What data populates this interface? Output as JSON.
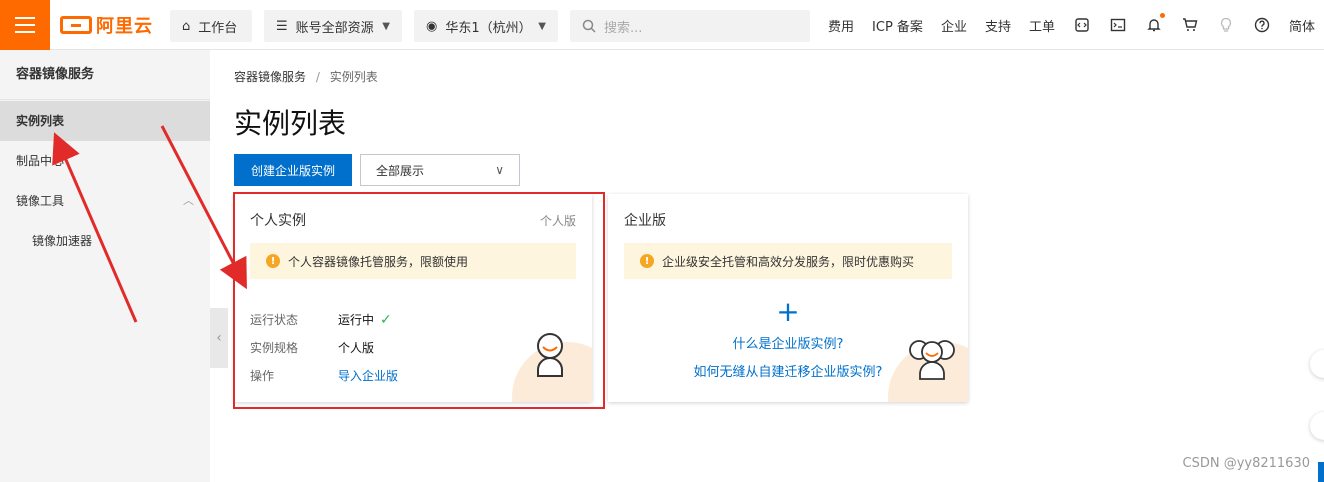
{
  "topbar": {
    "logo_text": "阿里云",
    "workbench": "工作台",
    "resources": "账号全部资源",
    "region": "华东1（杭州）",
    "search_placeholder": "搜索...",
    "links": [
      "费用",
      "ICP 备案",
      "企业",
      "支持",
      "工单"
    ],
    "lang": "简体",
    "accent_color": "#ff6a00"
  },
  "sidebar": {
    "title": "容器镜像服务",
    "items": [
      {
        "label": "实例列表",
        "active": true
      },
      {
        "label": "制品中心",
        "active": false
      },
      {
        "label": "镜像工具",
        "active": false,
        "expanded": true
      },
      {
        "label": "镜像加速器",
        "active": false,
        "sub": true
      }
    ]
  },
  "breadcrumb": {
    "parent": "容器镜像服务",
    "separator": "/",
    "current": "实例列表"
  },
  "page_title": "实例列表",
  "actions": {
    "create_button": "创建企业版实例",
    "filter_value": "全部展示"
  },
  "personal_card": {
    "title": "个人实例",
    "tag": "个人版",
    "notice": "个人容器镜像托管服务，限额使用",
    "status_label": "运行状态",
    "status_value": "运行中",
    "spec_label": "实例规格",
    "spec_value": "个人版",
    "op_label": "操作",
    "op_link": "导入企业版"
  },
  "enterprise_card": {
    "title": "企业版",
    "notice": "企业级安全托管和高效分发服务，限时优惠购买",
    "link1": "什么是企业版实例?",
    "link2": "如何无缝从自建迁移企业版实例?"
  },
  "watermark": "CSDN @yy8211630",
  "colors": {
    "primary": "#0070cc",
    "annotation": "#e12b2b",
    "success": "#2db44e"
  }
}
